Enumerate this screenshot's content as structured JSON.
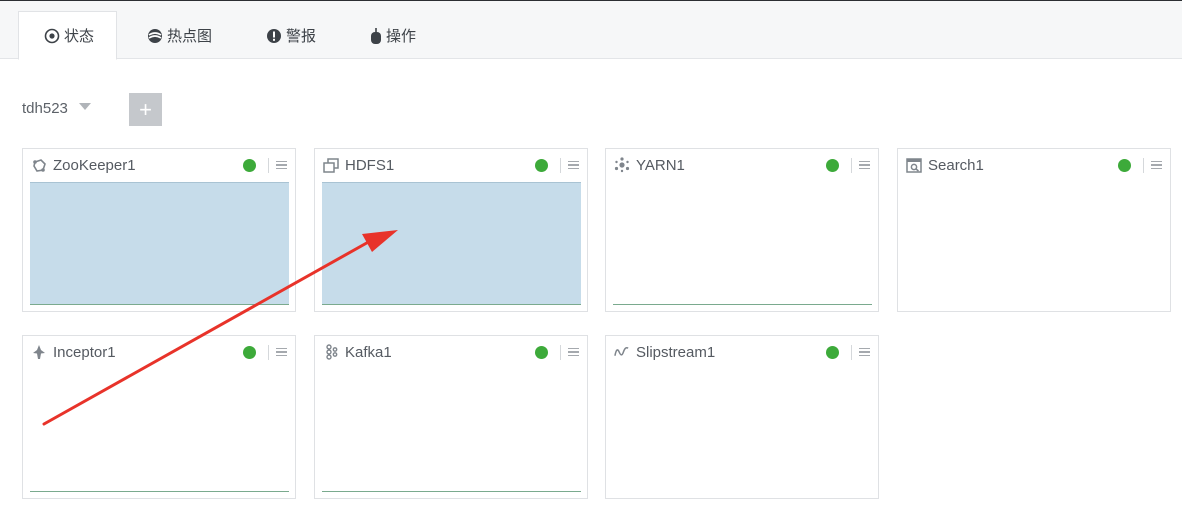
{
  "tabs": [
    {
      "label": "状态",
      "icon": "target-icon",
      "active": true
    },
    {
      "label": "热点图",
      "icon": "heatmap-icon",
      "active": false
    },
    {
      "label": "警报",
      "icon": "alert-icon",
      "active": false
    },
    {
      "label": "操作",
      "icon": "mouse-icon",
      "active": false
    }
  ],
  "cluster": {
    "name": "tdh523"
  },
  "add_button": {
    "label": "+"
  },
  "services": [
    {
      "name": "ZooKeeper1",
      "icon": "zookeeper-icon",
      "status": "green",
      "utilization": 1.0
    },
    {
      "name": "HDFS1",
      "icon": "hdfs-icon",
      "status": "green",
      "utilization": 1.0
    },
    {
      "name": "YARN1",
      "icon": "yarn-icon",
      "status": "green",
      "utilization": 0.0
    },
    {
      "name": "Search1",
      "icon": "search-icon",
      "status": "green",
      "utilization": null
    },
    {
      "name": "Inceptor1",
      "icon": "inceptor-icon",
      "status": "green",
      "utilization": 0.0
    },
    {
      "name": "Kafka1",
      "icon": "kafka-icon",
      "status": "green",
      "utilization": 0.0
    },
    {
      "name": "Slipstream1",
      "icon": "slipstream-icon",
      "status": "green",
      "utilization": null
    }
  ],
  "colors": {
    "status_ok": "#3daa3a",
    "chart_fill": "#c6dcea",
    "chart_line": "#7aaa8e",
    "annotation_arrow": "#e8332a"
  }
}
